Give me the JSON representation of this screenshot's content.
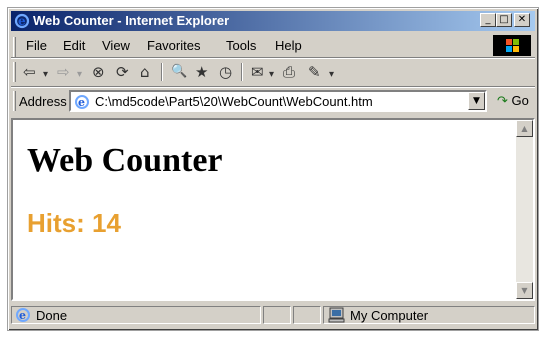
{
  "window": {
    "title": "Web Counter - Internet Explorer",
    "minimize_glyph": "_",
    "maximize_glyph": "□",
    "close_glyph": "✕"
  },
  "menu": {
    "items": [
      "File",
      "Edit",
      "View",
      "Favorites",
      "Tools",
      "Help"
    ]
  },
  "toolbar": {
    "back_glyph": "⇦",
    "forward_glyph": "⇨",
    "dropdown_glyph": "▾",
    "stop_glyph": "⊗",
    "refresh_glyph": "⟳",
    "home_glyph": "⌂",
    "search_glyph": "🔍",
    "favorites_glyph": "★",
    "history_glyph": "◷",
    "mail_glyph": "✉",
    "print_glyph": "⎙",
    "edit_glyph": "✎",
    "icons": [
      "back-icon",
      "forward-icon",
      "stop-icon",
      "refresh-icon",
      "home-icon",
      "search-icon",
      "favorites-icon",
      "history-icon",
      "mail-icon",
      "print-icon",
      "edit-icon"
    ]
  },
  "address": {
    "label": "Address",
    "value": "C:\\md5code\\Part5\\20\\WebCount\\WebCount.htm",
    "dropdown_glyph": "▼",
    "go_label": "Go",
    "go_glyph": "↷"
  },
  "page": {
    "heading": "Web Counter",
    "hits": "Hits: 14",
    "hits_color": "#e8a030"
  },
  "scrollbar": {
    "up_glyph": "▲",
    "down_glyph": "▼"
  },
  "status": {
    "left": "Done",
    "zone": "My Computer"
  },
  "colors": {
    "titlebar_start": "#0a246a",
    "titlebar_end": "#a6caf0",
    "chrome": "#d4d0c8"
  }
}
